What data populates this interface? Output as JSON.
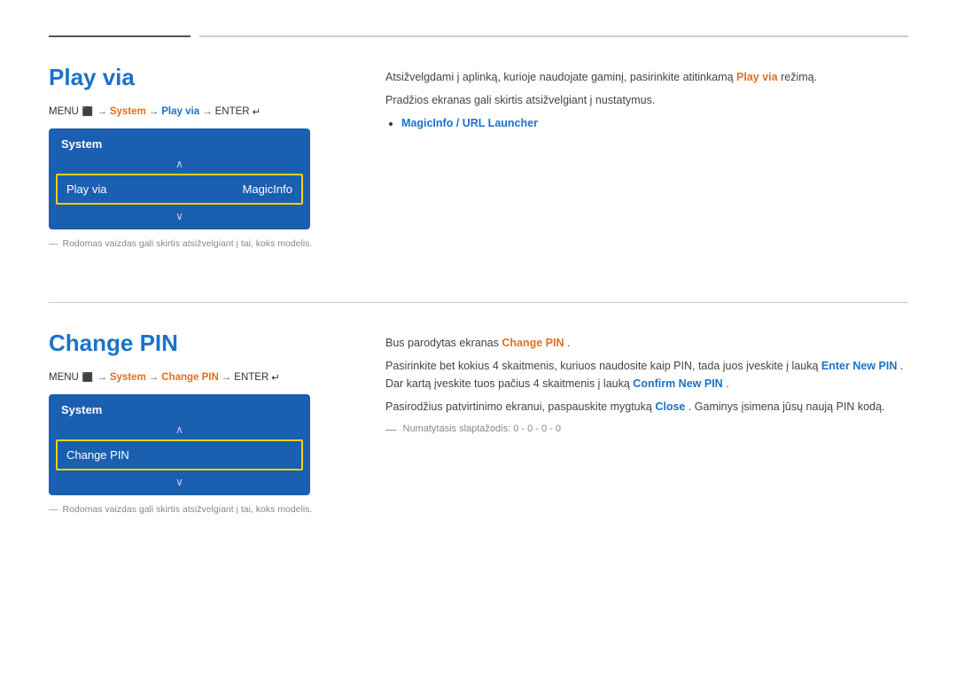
{
  "top_dividers": {
    "short": true,
    "long": true
  },
  "section1": {
    "title": "Play via",
    "menu_path": {
      "parts": [
        "MENU",
        "⬛",
        "→",
        "System",
        "→",
        "Play via",
        "→",
        "ENTER",
        "↵"
      ]
    },
    "tv_box": {
      "header": "System",
      "up_arrow": "∧",
      "item_label": "Play via",
      "item_value": "MagicInfo",
      "down_arrow": "∨"
    },
    "note": "Rodomas vaizdas gali skirtis atsižvelgiant į tai, koks modelis.",
    "right": {
      "line1": "Atsižvelgdami į aplinką, kurioje naudojate gaminį, pasirinkite atitinkamą",
      "play_via_word": "Play via",
      "line1_end": "režimą.",
      "line2": "Pradžios ekranas gali skirtis atsižvelgiant į nustatymus.",
      "bullet": "MagicInfo / URL Launcher"
    }
  },
  "section2": {
    "title": "Change PIN",
    "menu_path": {
      "parts": [
        "MENU",
        "⬛",
        "→",
        "System",
        "→",
        "Change PIN",
        "→",
        "ENTER",
        "↵"
      ]
    },
    "tv_box": {
      "header": "System",
      "up_arrow": "∧",
      "item_label": "Change PIN",
      "down_arrow": "∨"
    },
    "note": "Rodomas vaizdas gali skirtis atsižvelgiant į tai, koks modelis.",
    "right": {
      "line1_pre": "Bus parodytas ekranas",
      "change_pin": "Change PIN",
      "line1_end": ".",
      "line2_pre": "Pasirinkite bet kokius 4 skaitmenis, kuriuos naudosite kaip PIN, tada juos įveskite į lauką",
      "enter_new_pin": "Enter New PIN",
      "line2_mid": ". Dar kartą įveskite tuos pačius 4 skaitmenis į lauką",
      "confirm_new_pin": "Confirm New PIN",
      "line2_end": ".",
      "line3_pre": "Pasirodžius patvirtinimo ekranui, paspauskite mygtuką",
      "close": "Close",
      "line3_end": ". Gaminys įsimena jūsų naują PIN kodą.",
      "line4": "Numatytasis slaptažodis: 0 - 0 - 0 - 0"
    }
  }
}
